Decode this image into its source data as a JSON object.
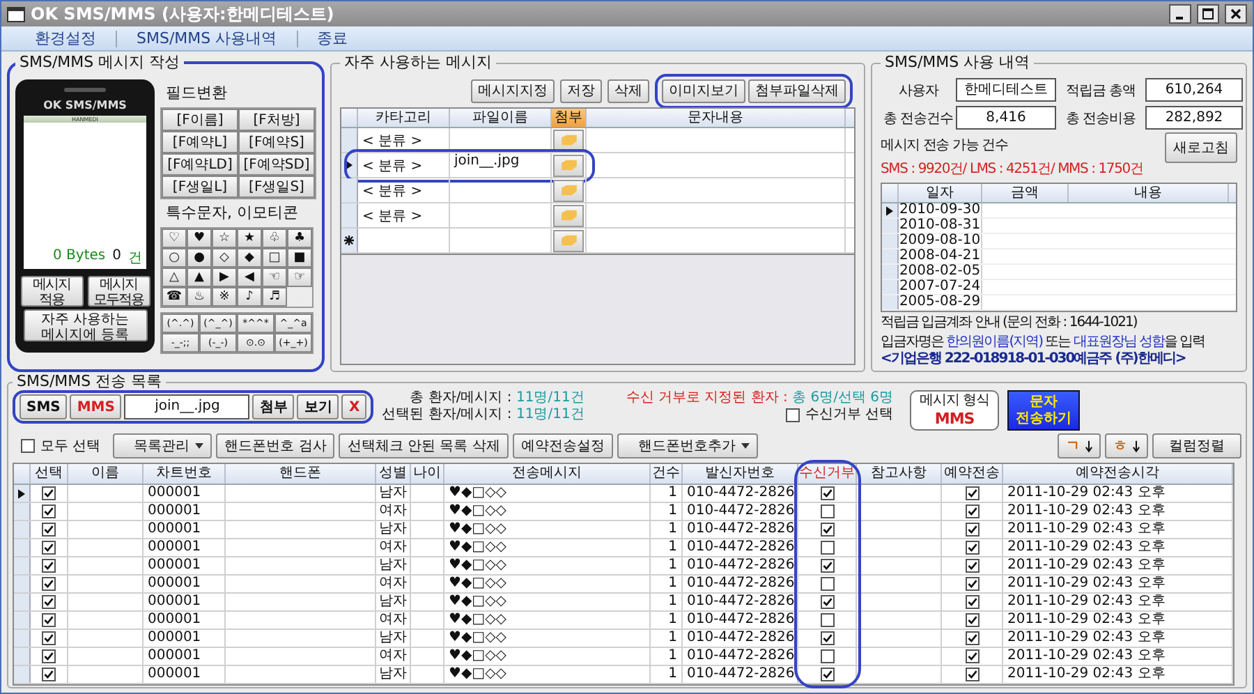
{
  "window": {
    "title": "OK SMS/MMS (사용자:한메디테스트)"
  },
  "menu": [
    "환경설정",
    "SMS/MMS 사용내역",
    "종료"
  ],
  "compose": {
    "title": "SMS/MMS 메시지 작성",
    "phone_brand": "OK SMS/MMS",
    "phone_carrier": "HANMEDI",
    "bytes": "0 Bytes",
    "count": "0",
    "count_unit": "건",
    "buttons": [
      "메시지\n적용",
      "메시지\n모두적용"
    ],
    "register_button": "자주 사용하는\n메시지에 등록",
    "field_title": "필드변환",
    "fields": [
      "[F이름]",
      "[F처방]",
      "[F예약L]",
      "[F예약S]",
      "[F예약LD]",
      "[F예약SD]",
      "[F생일L]",
      "[F생일S]"
    ],
    "symbols_title": "특수문자, 이모티콘",
    "symbols": [
      "♡",
      "♥",
      "☆",
      "★",
      "♧",
      "♣",
      "○",
      "●",
      "◇",
      "◆",
      "□",
      "■",
      "△",
      "▲",
      "▶",
      "◀",
      "☜",
      "☞",
      "☎",
      "♨",
      "※",
      "♪",
      "♬"
    ],
    "emoticons": [
      "(^.^)",
      "(^_^)",
      "*^^*",
      "^_^a",
      "-_-;;",
      "(-_-)",
      "⊙.⊙",
      "(+_+)"
    ]
  },
  "frequent": {
    "title": "자주 사용하는 메시지",
    "buttons": [
      "메시지지정",
      "저장",
      "삭제"
    ],
    "image_buttons": [
      "이미지보기",
      "첨부파일삭제"
    ],
    "columns": [
      "카타고리",
      "파일이름",
      "첨부",
      "문자내용"
    ],
    "rows": [
      {
        "category": "< 분류 >",
        "file": "",
        "selected": false,
        "outlined": false
      },
      {
        "category": "< 분류 >",
        "file": "join__.jpg",
        "selected": true,
        "outlined": true
      },
      {
        "category": "< 분류 >",
        "file": "",
        "selected": false,
        "outlined": false
      },
      {
        "category": "< 분류 >",
        "file": "",
        "selected": false,
        "outlined": false
      }
    ]
  },
  "usage": {
    "title": "SMS/MMS 사용 내역",
    "fields": [
      {
        "label": "사용자",
        "value": "한메디테스트"
      },
      {
        "label": "적립금 총액",
        "value": "610,264"
      },
      {
        "label": "총 전송건수",
        "value": "8,416"
      },
      {
        "label": "총 전송비용",
        "value": "282,892"
      }
    ],
    "available_label": "메시지 전송 가능 건수",
    "available": "SMS : 9920건/ LMS : 4251건/ MMS : 1750건",
    "refresh": "새로고침",
    "columns": [
      "일자",
      "금액",
      "내용"
    ],
    "rows": [
      {
        "date": "2010-09-30",
        "selected": true
      },
      {
        "date": "2010-08-31",
        "selected": false
      },
      {
        "date": "2009-08-10",
        "selected": false
      },
      {
        "date": "2008-04-21",
        "selected": false
      },
      {
        "date": "2008-02-05",
        "selected": false
      },
      {
        "date": "2007-07-24",
        "selected": false
      },
      {
        "date": "2005-08-29",
        "selected": false
      }
    ],
    "notice": "적립금 입금계좌 안내 (문의 전화 : 1644-1021)",
    "notice_parts": [
      {
        "text": "입금자명은 ",
        "highlight": false
      },
      {
        "text": "한의원이름(지역)",
        "highlight": true
      },
      {
        "text": " 또는 ",
        "highlight": false
      },
      {
        "text": "대표원장님 성함",
        "highlight": true
      },
      {
        "text": "을 입력",
        "highlight": false
      }
    ],
    "account": "<기업은행 222-018918-01-030예금주 (주)한메디>"
  },
  "send_list": {
    "title": "SMS/MMS 전송 목록",
    "type_buttons": [
      {
        "label": "SMS",
        "selected": false
      },
      {
        "label": "MMS",
        "selected": true
      }
    ],
    "attachment": "join__.jpg",
    "attach_button": "첨부",
    "view_button": "보기",
    "clear_button": "X",
    "stats": [
      {
        "label": "총 환자/메시지 :",
        "value": "11명/11건"
      },
      {
        "label": "선택된 환자/메시지 :",
        "value": "11명/11건"
      }
    ],
    "reject_stats": {
      "label": "수신 거부로 지정된 환자 :",
      "value": "총 6명/선택 6명"
    },
    "reject_select": {
      "label": "수신거부 선택",
      "checked": false
    },
    "format": {
      "label": "메시지 형식",
      "value": "MMS"
    },
    "send_button": "문자\n전송하기",
    "select_all": {
      "label": "모두 선택",
      "checked": false
    },
    "toolbar": [
      {
        "label": "목록관리",
        "dropdown": true
      },
      {
        "label": "핸드폰번호 검사",
        "dropdown": false
      },
      {
        "label": "선택체크 안된 목록 삭제",
        "dropdown": false
      },
      {
        "label": "예약전송설정",
        "dropdown": false
      },
      {
        "label": "핸드폰번호추가",
        "dropdown": true
      }
    ],
    "sort_buttons": [
      "ㄱ",
      "ㅎ"
    ],
    "align_button": "컬럼정렬",
    "columns": [
      {
        "label": "선택",
        "outlined": false,
        "alert": false
      },
      {
        "label": "이름",
        "outlined": false,
        "alert": false
      },
      {
        "label": "차트번호",
        "outlined": false,
        "alert": false
      },
      {
        "label": "핸드폰",
        "outlined": false,
        "alert": false
      },
      {
        "label": "성별",
        "outlined": false,
        "alert": false
      },
      {
        "label": "나이",
        "outlined": false,
        "alert": false
      },
      {
        "label": "전송메시지",
        "outlined": false,
        "alert": false
      },
      {
        "label": "건수",
        "outlined": false,
        "alert": false
      },
      {
        "label": "발신자번호",
        "outlined": false,
        "alert": false
      },
      {
        "label": "수신거부",
        "outlined": true,
        "alert": true
      },
      {
        "label": "참고사항",
        "outlined": false,
        "alert": false
      },
      {
        "label": "예약전송",
        "outlined": false,
        "alert": false
      },
      {
        "label": "예약전송시각",
        "outlined": false,
        "alert": false
      }
    ],
    "rows": [
      {
        "selected": true,
        "checked": true,
        "chart": "000001",
        "gender": "남자",
        "message": "♥◆□◇◇",
        "count": "1",
        "sender": "010-4472-2826",
        "reject": true,
        "reserved": true,
        "time": "2011-10-29 02:43 오후"
      },
      {
        "selected": false,
        "checked": true,
        "chart": "000001",
        "gender": "여자",
        "message": "♥◆□◇◇",
        "count": "1",
        "sender": "010-4472-2826",
        "reject": false,
        "reserved": true,
        "time": "2011-10-29 02:43 오후"
      },
      {
        "selected": false,
        "checked": true,
        "chart": "000001",
        "gender": "남자",
        "message": "♥◆□◇◇",
        "count": "1",
        "sender": "010-4472-2826",
        "reject": true,
        "reserved": true,
        "time": "2011-10-29 02:43 오후"
      },
      {
        "selected": false,
        "checked": true,
        "chart": "000001",
        "gender": "여자",
        "message": "♥◆□◇◇",
        "count": "1",
        "sender": "010-4472-2826",
        "reject": false,
        "reserved": true,
        "time": "2011-10-29 02:43 오후"
      },
      {
        "selected": false,
        "checked": true,
        "chart": "000001",
        "gender": "남자",
        "message": "♥◆□◇◇",
        "count": "1",
        "sender": "010-4472-2826",
        "reject": true,
        "reserved": true,
        "time": "2011-10-29 02:43 오후"
      },
      {
        "selected": false,
        "checked": true,
        "chart": "000001",
        "gender": "여자",
        "message": "♥◆□◇◇",
        "count": "1",
        "sender": "010-4472-2826",
        "reject": false,
        "reserved": true,
        "time": "2011-10-29 02:43 오후"
      },
      {
        "selected": false,
        "checked": true,
        "chart": "000001",
        "gender": "남자",
        "message": "♥◆□◇◇",
        "count": "1",
        "sender": "010-4472-2826",
        "reject": true,
        "reserved": true,
        "time": "2011-10-29 02:43 오후"
      },
      {
        "selected": false,
        "checked": true,
        "chart": "000001",
        "gender": "여자",
        "message": "♥◆□◇◇",
        "count": "1",
        "sender": "010-4472-2826",
        "reject": false,
        "reserved": true,
        "time": "2011-10-29 02:43 오후"
      },
      {
        "selected": false,
        "checked": true,
        "chart": "000001",
        "gender": "남자",
        "message": "♥◆□◇◇",
        "count": "1",
        "sender": "010-4472-2826",
        "reject": true,
        "reserved": true,
        "time": "2011-10-29 02:43 오후"
      },
      {
        "selected": false,
        "checked": true,
        "chart": "000001",
        "gender": "여자",
        "message": "♥◆□◇◇",
        "count": "1",
        "sender": "010-4472-2826",
        "reject": false,
        "reserved": true,
        "time": "2011-10-29 02:43 오후"
      },
      {
        "selected": false,
        "checked": true,
        "chart": "000001",
        "gender": "남자",
        "message": "♥◆□◇◇",
        "count": "1",
        "sender": "010-4472-2826",
        "reject": true,
        "reserved": true,
        "time": "2011-10-29 02:43 오후"
      }
    ]
  }
}
